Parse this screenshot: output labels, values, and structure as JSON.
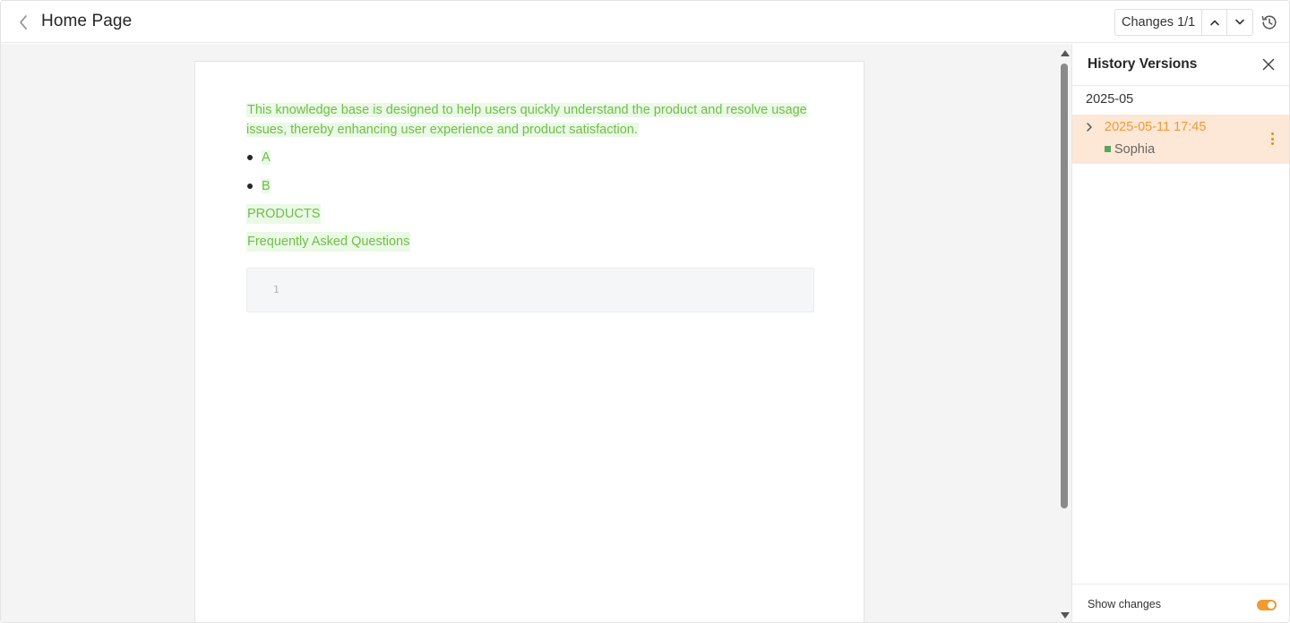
{
  "header": {
    "title": "Home Page",
    "changes_label": "Changes 1/1"
  },
  "document": {
    "paragraph": "This knowledge base is designed to help users quickly understand the product and resolve usage issues, thereby enhancing user experience and product satisfaction.",
    "bullets": [
      "A",
      "B"
    ],
    "line1": "PRODUCTS",
    "line2": "Frequently Asked Questions",
    "code_line_number": "1"
  },
  "history_panel": {
    "title": "History Versions",
    "month": "2025-05",
    "versions": [
      {
        "time": "2025-05-11 17:45",
        "author": "Sophia"
      }
    ],
    "show_changes_label": "Show changes",
    "show_changes_enabled": true
  },
  "colors": {
    "change_text": "#6fbf45",
    "change_bg": "#ebf9e7",
    "accent": "#f29a2e",
    "selected_bg": "#fde7d6",
    "author_marker": "#58a55c"
  }
}
